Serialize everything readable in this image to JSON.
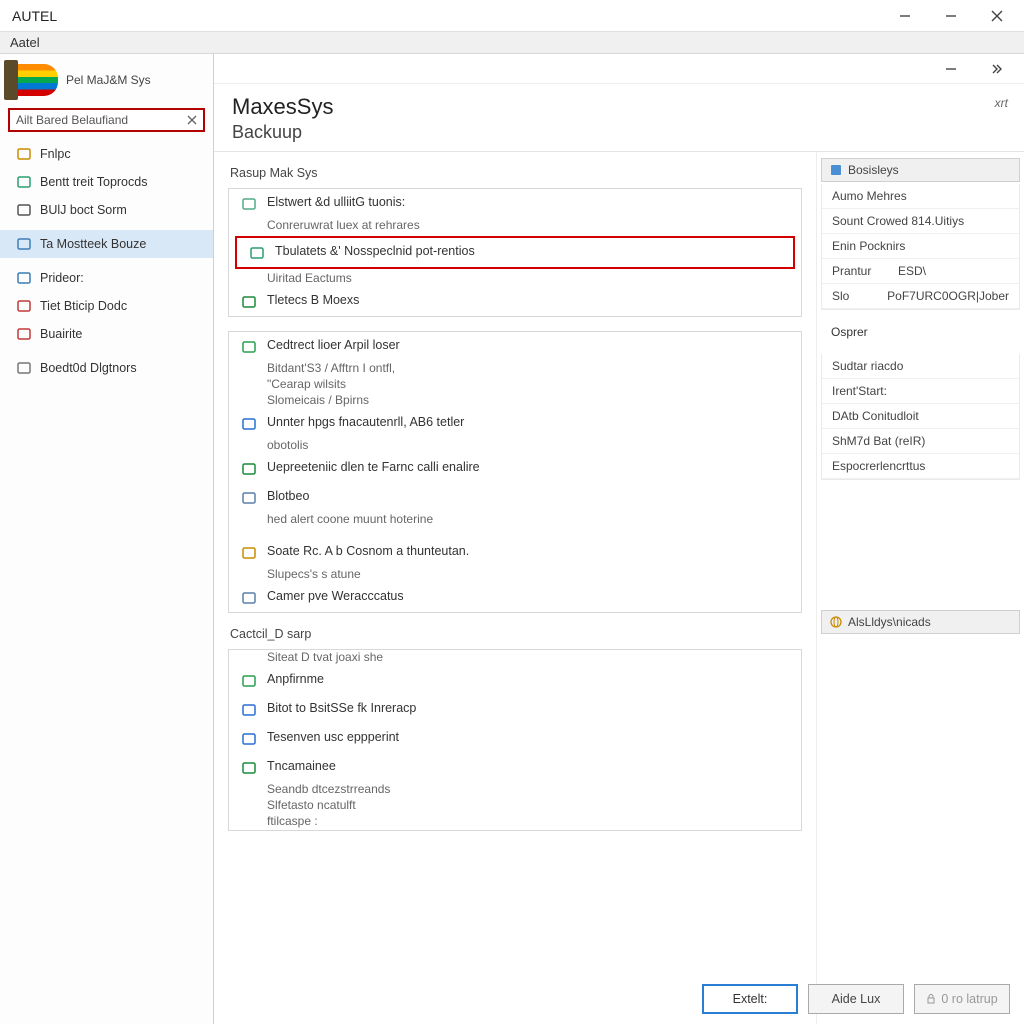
{
  "outer_window": {
    "title": "AUTEL"
  },
  "menu": {
    "item1": "Aatel"
  },
  "sidebar": {
    "brand": "Pel MaJ&M Sys",
    "search_value": "Ailt Bared Belaufiand",
    "items": [
      {
        "label": "Fnlpc",
        "icon": "power-icon",
        "color": "#c98b00"
      },
      {
        "label": "Bentt treit Toprocds",
        "icon": "sparkle-icon",
        "color": "#2a9e6f"
      },
      {
        "label": "BUlJ boct Sorm",
        "icon": "page-icon",
        "color": "#555"
      },
      {
        "label": "Ta Mostteek Bouze",
        "icon": "link-icon",
        "color": "#3a7fb8",
        "selected": true
      },
      {
        "label": "Prideor:",
        "icon": "card-icon",
        "color": "#3a7fb8"
      },
      {
        "label": "Tiet Bticip Dodc",
        "icon": "doc-icon",
        "color": "#c23a3a"
      },
      {
        "label": "Buairite",
        "icon": "grid-icon",
        "color": "#c23a3a"
      },
      {
        "label": "Boedt0d Dlgtnors",
        "icon": "list-icon",
        "color": "#777"
      }
    ]
  },
  "page": {
    "title": "MaxesSys",
    "subtitle": "Backuup",
    "top_right": "xrt",
    "section_label": "Rasup Mak Sys",
    "group1": [
      {
        "label": "Elstwert &d ulliitG tuonis:",
        "icon": "cloud-icon",
        "color": "#5a8"
      },
      {
        "label": "Conreruwrat luex at rehrares",
        "sub": true
      },
      {
        "label": "Tbulatets  &' Nosspeclnid pot-rentios",
        "icon": "table-icon",
        "color": "#2a9e6f",
        "hl": true
      },
      {
        "label": "Uiritad Eactums",
        "sub": true
      },
      {
        "label": "Tletecs B Moexs",
        "icon": "square-icon",
        "color": "#1a8a3a"
      }
    ],
    "group2": [
      {
        "label": "Cedtrect lioer Arpil loser",
        "icon": "chat-icon",
        "color": "#2a9e4e"
      },
      {
        "label": "Bitdant'S3 / Afftrn I ontfl,",
        "sub": true
      },
      {
        "label": "\"Cearap wilsits",
        "sub": true
      },
      {
        "label": "Slomeicais / Bpirns",
        "sub": true
      },
      {
        "label": "Unnter hpgs  fnacautenrll, AB6 tetler",
        "icon": "shield-icon",
        "color": "#2a6fd4"
      },
      {
        "label": "obotolis",
        "sub": true
      },
      {
        "label": "Uepreeteniic dlen te Farnc calli enalire",
        "icon": "doc-green-icon",
        "color": "#1a8a3a"
      },
      {
        "label": "Blotbeo",
        "icon": "page2-icon",
        "color": "#5a7fa8"
      },
      {
        "label": "hed alert coone muunt hoterine",
        "sub": true
      }
    ],
    "group2b": [
      {
        "label": "Soate Rc. A b Cosnom a thunteutan.",
        "icon": "warn-icon",
        "color": "#c98b00"
      },
      {
        "label": "Slupecs's s atune",
        "sub": true
      },
      {
        "label": "Camer pve Weracccatus",
        "icon": "folder-icon",
        "color": "#5a7fa8"
      }
    ],
    "section_label2": "Cactcil_D sarp",
    "group3": [
      {
        "label": "Siteat D tvat joaxi she",
        "sub": true
      },
      {
        "label": "Anpfirnme",
        "icon": "pic-icon",
        "color": "#2a9e4e"
      },
      {
        "label": "Bitot to BsitSSe fk Inreracp",
        "icon": "blue-icon",
        "color": "#2a6fd4"
      },
      {
        "label": "Tesenven usc eppperint",
        "icon": "bars-icon",
        "color": "#2a6fd4"
      },
      {
        "label": "Tncamainee",
        "icon": "card2-icon",
        "color": "#1a8a3a"
      },
      {
        "label": "Seandb dtcezstrreands",
        "sub": true
      },
      {
        "label": "Slfetasto ncatulft",
        "sub": true
      },
      {
        "label": "ftilcaspe :",
        "sub": true
      }
    ]
  },
  "right_panel": {
    "header1": "Bosisleys",
    "items1": [
      {
        "label": "Aumo Mehres"
      },
      {
        "label": "Sount Crowed 814.Uitiys"
      },
      {
        "label": "Enin Pocknirs"
      },
      {
        "k": "Prantur",
        "v": "ESD\\"
      },
      {
        "k": "Slo",
        "v": "PoF7URC0OGR|Jober"
      }
    ],
    "items2_head": "Osprer",
    "items2": [
      "Sudtar riacdo",
      "Irent'Start:",
      "DAtb Conitudloit",
      "ShM7d Bat (reIR)",
      "Espocrerlencrttus"
    ],
    "header2": "AlsLldys\\nicads"
  },
  "footer": {
    "btn1": "Extelt:",
    "btn2": "Aide Lux",
    "btn3": "0 ro latrup"
  }
}
